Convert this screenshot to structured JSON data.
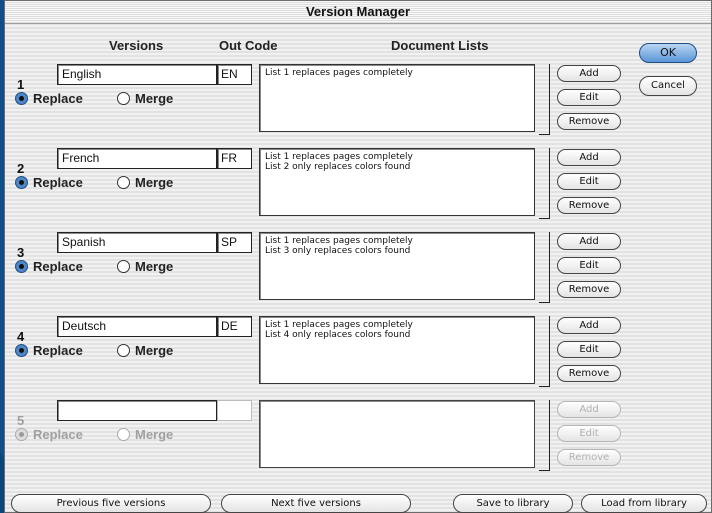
{
  "window": {
    "title": "Version Manager"
  },
  "headers": {
    "versions": "Versions",
    "out_code": "Out Code",
    "document_lists": "Document Lists"
  },
  "dialog_buttons": {
    "ok": "OK",
    "cancel": "Cancel"
  },
  "rows": [
    {
      "number": "1",
      "name": "English",
      "code": "EN",
      "mode": "Replace",
      "lists": [
        "List 1 replaces pages completely"
      ],
      "enabled": true
    },
    {
      "number": "2",
      "name": "French",
      "code": "FR",
      "mode": "Replace",
      "lists": [
        "List 1 replaces pages completely",
        "List 2 only replaces colors found"
      ],
      "enabled": true
    },
    {
      "number": "3",
      "name": "Spanish",
      "code": "SP",
      "mode": "Replace",
      "lists": [
        "List 1 replaces pages completely",
        "List 3 only replaces colors found"
      ],
      "enabled": true
    },
    {
      "number": "4",
      "name": "Deutsch",
      "code": "DE",
      "mode": "Replace",
      "lists": [
        "List 1 replaces pages completely",
        "List 4 only replaces colors found"
      ],
      "enabled": true
    },
    {
      "number": "5",
      "name": "",
      "code": "",
      "mode": "Replace",
      "lists": [],
      "enabled": false
    }
  ],
  "row_labels": {
    "replace": "Replace",
    "merge": "Merge",
    "add": "Add",
    "edit": "Edit",
    "remove": "Remove"
  },
  "bottom_buttons": {
    "previous": "Previous five versions",
    "next": "Next five versions",
    "save": "Save to library",
    "load": "Load from library"
  },
  "colors": {
    "accent": "#5b95d6",
    "background": "#0d4f86"
  }
}
